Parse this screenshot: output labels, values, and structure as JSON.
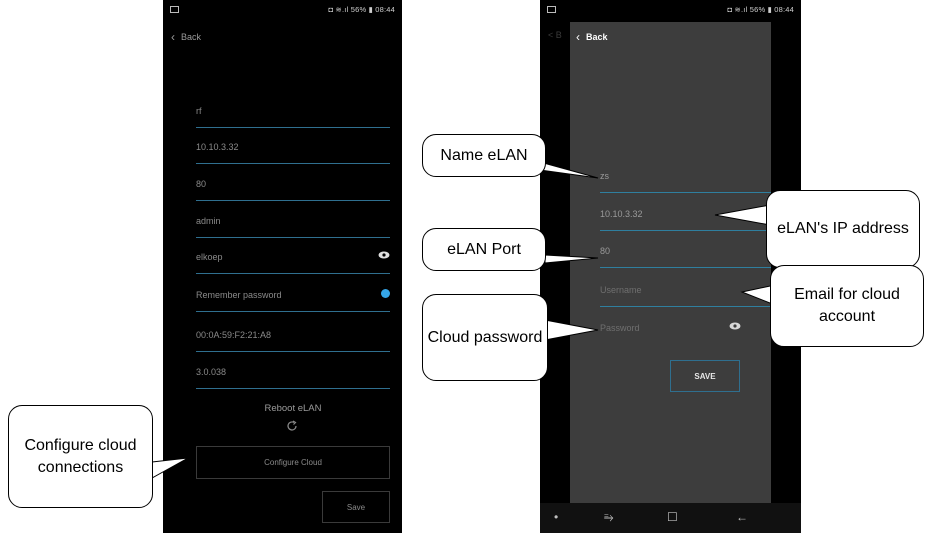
{
  "status_bar": {
    "left_phone": "◘ ≋.ıl 56% ▮ 08:44",
    "right_phone": "◘ ≋.ıl 56% ▮ 08:44"
  },
  "left_screen": {
    "back_label": "Back",
    "fields": [
      {
        "name": "elan-name",
        "value": "rf"
      },
      {
        "name": "ip-address",
        "value": "10.10.3.32"
      },
      {
        "name": "port",
        "value": "80"
      },
      {
        "name": "username",
        "value": "admin"
      },
      {
        "name": "password",
        "value": "elkoep"
      },
      {
        "name": "remember-password",
        "value": "Remember password"
      },
      {
        "name": "mac-address",
        "value": "00:0A:59:F2:21:A8"
      },
      {
        "name": "firmware-version",
        "value": "3.0.038"
      }
    ],
    "reboot_label": "Reboot eLAN",
    "configure_cloud_label": "Configure Cloud",
    "save_label": "Save"
  },
  "right_screen": {
    "ghost_back_label": "< B",
    "dialog_back_label": "Back",
    "fields": [
      {
        "name": "elan-name",
        "value": "zs"
      },
      {
        "name": "ip-address",
        "value": "10.10.3.32"
      },
      {
        "name": "port",
        "value": "80"
      },
      {
        "name": "username",
        "placeholder": "Username"
      },
      {
        "name": "password",
        "placeholder": "Password"
      }
    ],
    "save_label": "SAVE",
    "nav": {
      "dot": "•",
      "recent": "⥱",
      "home": "☐",
      "back": "←"
    }
  },
  "callouts": {
    "configure_cloud": "Configure cloud connections",
    "name_elan": "Name eLAN",
    "elan_port": "eLAN Port",
    "cloud_password": "Cloud password",
    "elan_ip": "eLAN's IP address",
    "email_cloud": "Email for cloud account"
  },
  "colors": {
    "accent": "#35a6e8",
    "underline": "#2f6f8f",
    "dialog_bg": "#3d3d3d"
  }
}
